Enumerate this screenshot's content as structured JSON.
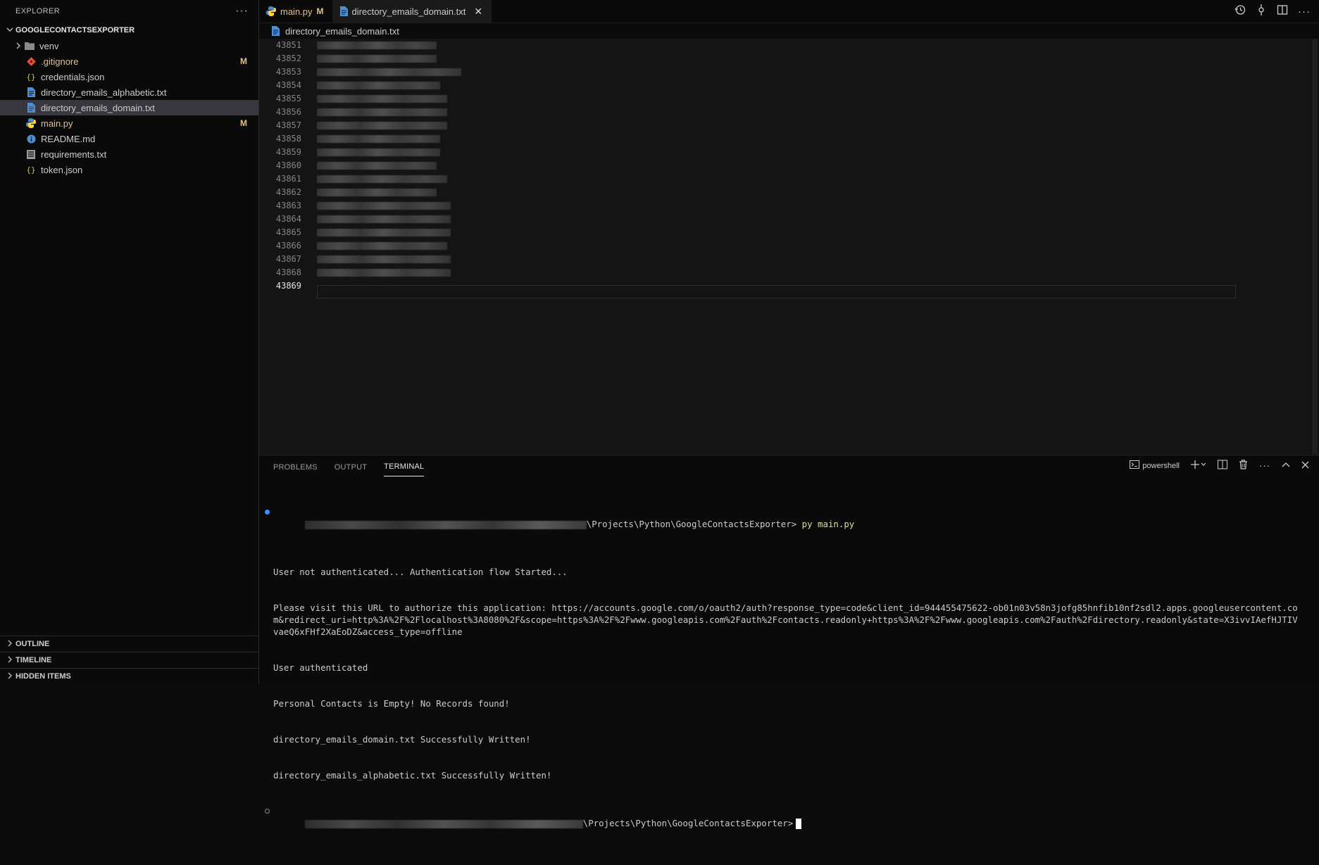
{
  "sidebar": {
    "title": "EXPLORER",
    "more": "···",
    "project": "GOOGLECONTACTSEXPORTER",
    "items": [
      {
        "label": "venv",
        "icon": "folder-icon",
        "badge": "",
        "color": "#cccccc"
      },
      {
        "label": ".gitignore",
        "icon": "git-icon",
        "badge": "M",
        "color": "#e2c08d"
      },
      {
        "label": "credentials.json",
        "icon": "json-icon",
        "badge": "",
        "color": "#cccccc"
      },
      {
        "label": "directory_emails_alphabetic.txt",
        "icon": "text-file-icon",
        "badge": "",
        "color": "#cccccc"
      },
      {
        "label": "directory_emails_domain.txt",
        "icon": "text-file-icon",
        "badge": "",
        "color": "#cccccc"
      },
      {
        "label": "main.py",
        "icon": "python-icon",
        "badge": "M",
        "color": "#e2c08d"
      },
      {
        "label": "README.md",
        "icon": "info-icon",
        "badge": "",
        "color": "#cccccc"
      },
      {
        "label": "requirements.txt",
        "icon": "list-file-icon",
        "badge": "",
        "color": "#cccccc"
      },
      {
        "label": "token.json",
        "icon": "json-icon",
        "badge": "",
        "color": "#cccccc"
      }
    ],
    "sections": [
      "OUTLINE",
      "TIMELINE",
      "HIDDEN ITEMS"
    ]
  },
  "tabs": [
    {
      "label": "main.py",
      "modified": "M",
      "active": false
    },
    {
      "label": "directory_emails_domain.txt",
      "close": "✕",
      "active": true
    }
  ],
  "breadcrumb": "directory_emails_domain.txt",
  "editor": {
    "line_numbers": [
      "43851",
      "43852",
      "43853",
      "43854",
      "43855",
      "43856",
      "43857",
      "43858",
      "43859",
      "43860",
      "43861",
      "43862",
      "43863",
      "43864",
      "43865",
      "43866",
      "43867",
      "43868",
      "43869"
    ],
    "current_line": "43869"
  },
  "panel": {
    "tabs": [
      "PROBLEMS",
      "OUTPUT",
      "TERMINAL"
    ],
    "active_tab": "TERMINAL",
    "shell": "powershell",
    "terminal": {
      "prompt1_path": "\\Projects\\Python\\GoogleContactsExporter>",
      "command": "py main.py",
      "output": [
        "User not authenticated... Authentication flow Started...",
        "Please visit this URL to authorize this application: https://accounts.google.com/o/oauth2/auth?response_type=code&client_id=944455475622-ob01n03v58n3jofg85hnfib10nf2sdl2.apps.googleusercontent.com&redirect_uri=http%3A%2F%2Flocalhost%3A8080%2F&scope=https%3A%2F%2Fwww.googleapis.com%2Fauth%2Fcontacts.readonly+https%3A%2F%2Fwww.googleapis.com%2Fauth%2Fdirectory.readonly&state=X3ivvIAefHJTIVvaeQ6xFHf2XaEoDZ&access_type=offline",
        "User authenticated",
        "Personal Contacts is Empty! No Records found!",
        "directory_emails_domain.txt Successfully Written!",
        "directory_emails_alphabetic.txt Successfully Written!"
      ],
      "prompt2_path": "\\Projects\\Python\\GoogleContactsExporter>"
    }
  },
  "colors": {
    "accent_modified": "#e2c08d",
    "selection": "#37373d",
    "python_blue": "#4b8bbe",
    "python_yellow": "#ffd43b",
    "git_red": "#e84d31",
    "json_yellow": "#cbcb41",
    "file_blue": "#4a90d9"
  }
}
